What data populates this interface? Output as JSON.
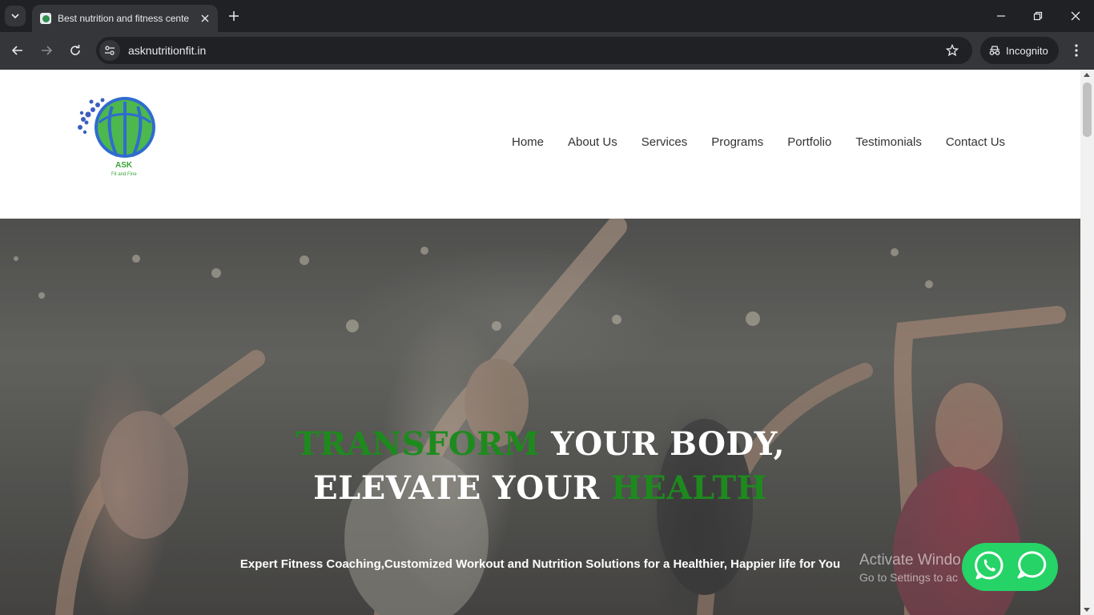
{
  "browser": {
    "tab_title": "Best nutrition and fitness cente",
    "url": "asknutritionfit.in",
    "incognito_label": "Incognito"
  },
  "site": {
    "logo_text": "ASK",
    "logo_tagline": "Fit and Fine",
    "nav": [
      "Home",
      "About Us",
      "Services",
      "Programs",
      "Portfolio",
      "Testimonials",
      "Contact Us"
    ]
  },
  "hero": {
    "line1_green": "TRANSFORM",
    "line1_white": "YOUR BODY,",
    "line2_white": "ELEVATE YOUR",
    "line2_green": "HEALTH",
    "subtitle": "Expert Fitness Coaching,Customized Workout and Nutrition Solutions for a Healthier, Happier life for You"
  },
  "watermark": {
    "line1": "Activate Windo",
    "line2": "Go to Settings to ac"
  },
  "chat": {
    "icons": [
      "whatsapp-icon",
      "chat-bubble-icon"
    ],
    "color": "#25d366"
  },
  "colors": {
    "accent_green": "#1e8a1e",
    "chrome_dark": "#202124",
    "chrome_mid": "#35363a"
  }
}
